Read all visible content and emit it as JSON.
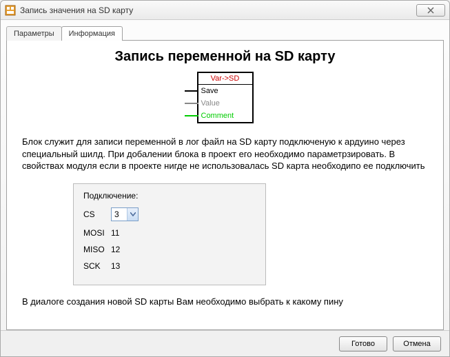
{
  "window": {
    "title": "Запись значения на SD карту"
  },
  "tabs": {
    "params": "Параметры",
    "info": "Информация"
  },
  "content": {
    "heading": "Запись переменной на SD карту",
    "block": {
      "header": "Var->SD",
      "pins": {
        "save": "Save",
        "value": "Value",
        "comment": "Comment"
      }
    },
    "description": "Блок служит для записи переменной в лог файл на SD карту подключеную к ардуино через специальный шилд. При добалении блока в проект его необходимо параметрзировать. В свойствах модуля если в проекте нигде не использовалась SD карта необходипо ее подключить",
    "connection": {
      "title": "Подключение:",
      "rows": {
        "cs": {
          "label": "CS",
          "value": "3"
        },
        "mosi": {
          "label": "MOSI",
          "value": "11"
        },
        "miso": {
          "label": "MISO",
          "value": "12"
        },
        "sck": {
          "label": "SCK",
          "value": "13"
        }
      }
    },
    "footer_text": "В диалоге создания новой SD карты Вам необходимо выбрать к какому пину"
  },
  "buttons": {
    "ready": "Готово",
    "cancel": "Отмена"
  }
}
